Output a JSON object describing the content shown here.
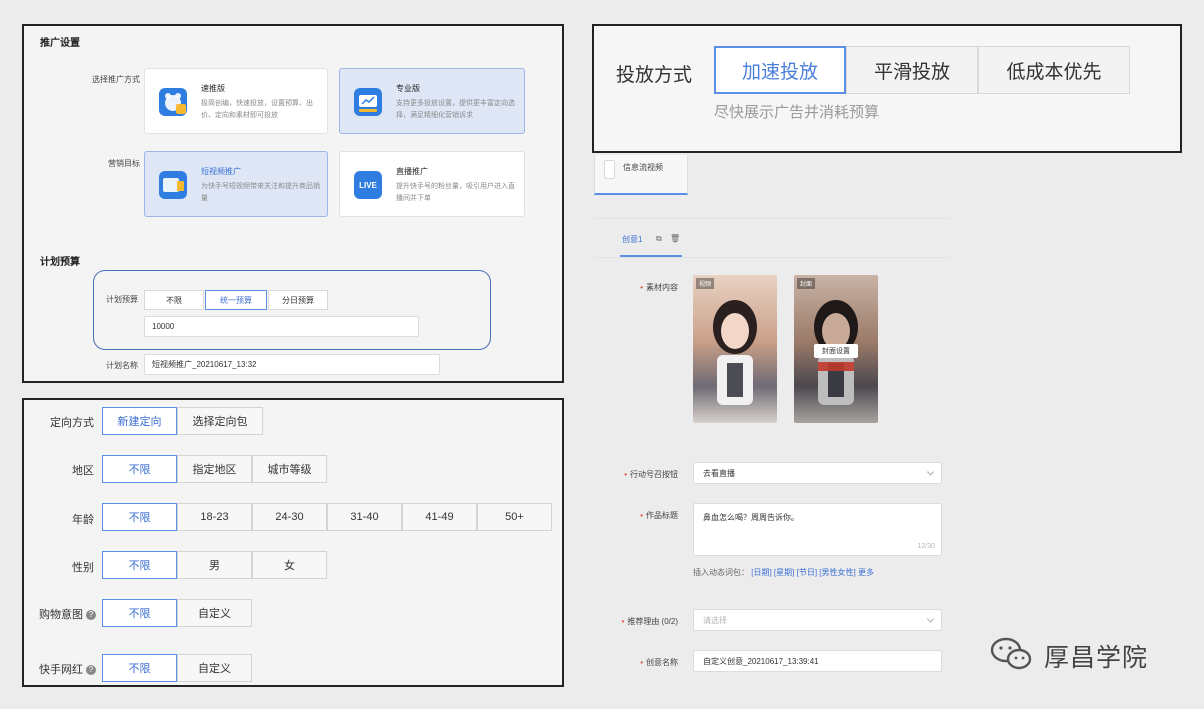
{
  "promo": {
    "title": "推广设置",
    "method_label": "选择推广方式",
    "methods": [
      {
        "title": "速推版",
        "desc": "极简创编，快速投放，设置预算、出价、定向和素材即可投放"
      },
      {
        "title": "专业版",
        "desc": "支持更多投放设置，提供更丰富定向选择，满足精细化营销诉求"
      }
    ],
    "goal_label": "营销目标",
    "goals": [
      {
        "title": "短视频推广",
        "desc": "为快手号短视频带来关注和提升商品销量"
      },
      {
        "title": "直播推广",
        "desc": "提升快手号的粉丝量，吸引用户进入直播间并下单",
        "icon_text": "LIVE"
      }
    ]
  },
  "plan": {
    "title": "计划预算",
    "budget_label": "计划预算",
    "budget_options": [
      "不限",
      "统一预算",
      "分日预算"
    ],
    "budget_value": "10000",
    "name_label": "计划名称",
    "name_value": "短视频推广_20210617_13:32"
  },
  "targeting": {
    "method_label": "定向方式",
    "method_options": [
      "新建定向",
      "选择定向包"
    ],
    "region_label": "地区",
    "region_options": [
      "不限",
      "指定地区",
      "城市等级"
    ],
    "age_label": "年龄",
    "age_options": [
      "不限",
      "18-23",
      "24-30",
      "31-40",
      "41-49",
      "50+"
    ],
    "gender_label": "性别",
    "gender_options": [
      "不限",
      "男",
      "女"
    ],
    "shopping_label": "购物意图",
    "shopping_options": [
      "不限",
      "自定义"
    ],
    "kol_label": "快手网红",
    "kol_options": [
      "不限",
      "自定义"
    ]
  },
  "delivery": {
    "label": "投放方式",
    "options": [
      "加速投放",
      "平滑投放",
      "低成本优先"
    ],
    "hint": "尽快展示广告并消耗预算"
  },
  "creative": {
    "type_tab": "信息流视频",
    "creative_tab": "创意1",
    "material_label": "素材内容",
    "thumb1_tag": "视频",
    "thumb2_tag": "封面",
    "cover_button": "封面设置",
    "cta_label": "行动号召按钮",
    "cta_value": "去看直播",
    "title_label": "作品标题",
    "title_value": "鼻血怎么喝？周周告诉你。",
    "title_count": "12/30",
    "insert_label": "插入动态词包：",
    "insert_words": [
      "[日期]",
      "[星期]",
      "[节日]",
      "[男性女性]",
      "更多"
    ],
    "reason_label": "推荐理由 (0/2)",
    "reason_placeholder": "请选择",
    "name_label": "创意名称",
    "name_value": "自定义创意_20210617_13:39:41"
  },
  "watermark": {
    "text": "厚昌学院"
  },
  "colors": {
    "accent": "#3b6fd4",
    "selected_bg": "#dfe7f7",
    "required": "#e0463c"
  }
}
